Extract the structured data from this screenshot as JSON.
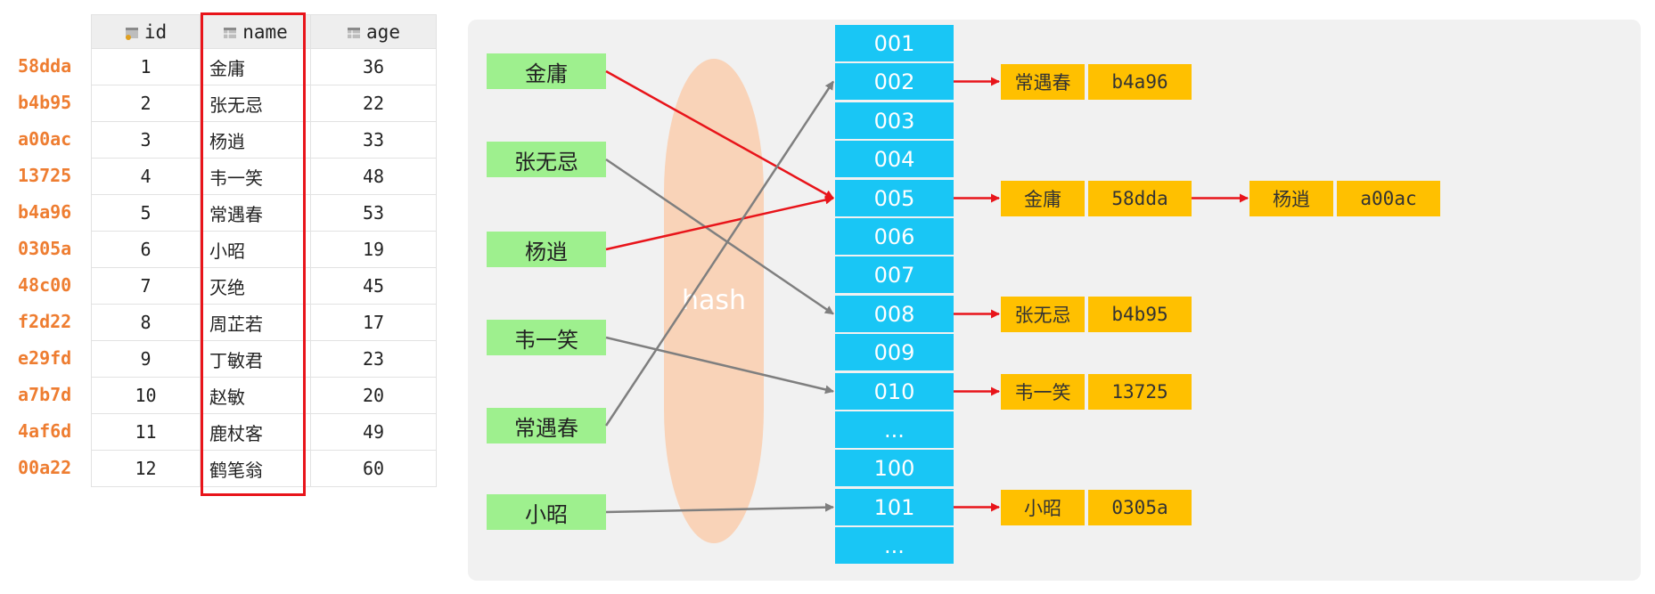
{
  "hashes": [
    "58dda",
    "b4b95",
    "a00ac",
    "13725",
    "b4a96",
    "0305a",
    "48c00",
    "f2d22",
    "e29fd",
    "a7b7d",
    "4af6d",
    "00a22"
  ],
  "table": {
    "columns": [
      "id",
      "name",
      "age"
    ],
    "rows": [
      {
        "id": "1",
        "name": "金庸",
        "age": "36"
      },
      {
        "id": "2",
        "name": "张无忌",
        "age": "22"
      },
      {
        "id": "3",
        "name": "杨逍",
        "age": "33"
      },
      {
        "id": "4",
        "name": "韦一笑",
        "age": "48"
      },
      {
        "id": "5",
        "name": "常遇春",
        "age": "53"
      },
      {
        "id": "6",
        "name": "小昭",
        "age": "19"
      },
      {
        "id": "7",
        "name": "灭绝",
        "age": "45"
      },
      {
        "id": "8",
        "name": "周芷若",
        "age": "17"
      },
      {
        "id": "9",
        "name": "丁敏君",
        "age": "23"
      },
      {
        "id": "10",
        "name": "赵敏",
        "age": "20"
      },
      {
        "id": "11",
        "name": "鹿杖客",
        "age": "49"
      },
      {
        "id": "12",
        "name": "鹤笔翁",
        "age": "60"
      }
    ]
  },
  "hash_label": "hash",
  "keys": [
    "金庸",
    "张无忌",
    "杨逍",
    "韦一笑",
    "常遇春",
    "小昭"
  ],
  "buckets": [
    "001",
    "002",
    "003",
    "004",
    "005",
    "006",
    "007",
    "008",
    "009",
    "010",
    "...",
    "100",
    "101",
    "..."
  ],
  "entries": [
    {
      "bucket": "002",
      "name": "常遇春",
      "hash": "b4a96"
    },
    {
      "bucket": "005",
      "name": "金庸",
      "hash": "58dda"
    },
    {
      "bucket": "005",
      "name": "杨逍",
      "hash": "a00ac"
    },
    {
      "bucket": "008",
      "name": "张无忌",
      "hash": "b4b95"
    },
    {
      "bucket": "010",
      "name": "韦一笑",
      "hash": "13725"
    },
    {
      "bucket": "101",
      "name": "小昭",
      "hash": "0305a"
    }
  ],
  "key_to_bucket": [
    {
      "key": "金庸",
      "bucket": "005",
      "color": "#e8141a"
    },
    {
      "key": "张无忌",
      "bucket": "008",
      "color": "#7f7f7f"
    },
    {
      "key": "杨逍",
      "bucket": "005",
      "color": "#e8141a"
    },
    {
      "key": "韦一笑",
      "bucket": "010",
      "color": "#7f7f7f"
    },
    {
      "key": "常遇春",
      "bucket": "002",
      "color": "#7f7f7f"
    },
    {
      "key": "小昭",
      "bucket": "101",
      "color": "#7f7f7f"
    }
  ],
  "colors": {
    "hash_text": "#ee7d31",
    "highlight": "#e8141a",
    "key_fill": "#9ef08e",
    "bucket_fill": "#19c6f5",
    "entry_fill": "#ffc000",
    "ellipse_fill": "#f9d3b8",
    "panel_bg": "#f1f1f1",
    "arrow_red": "#e8141a",
    "arrow_gray": "#7f7f7f"
  }
}
